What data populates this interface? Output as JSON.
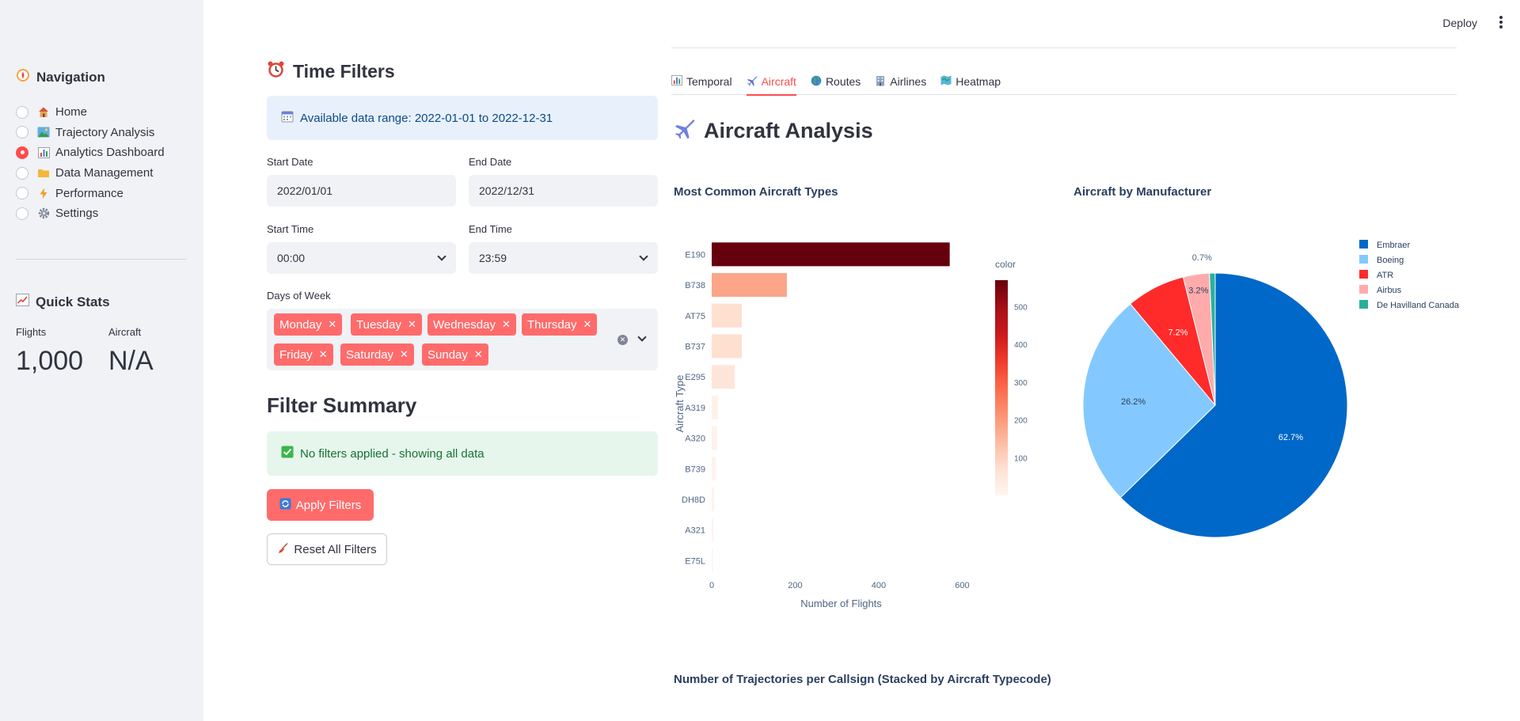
{
  "sidebar": {
    "nav_title": "Navigation",
    "nav_items": [
      {
        "label": "Home",
        "icon": "house-icon",
        "selected": false
      },
      {
        "label": "Trajectory Analysis",
        "icon": "landscape-icon",
        "selected": false
      },
      {
        "label": "Analytics Dashboard",
        "icon": "bar-chart-icon",
        "selected": true
      },
      {
        "label": "Data Management",
        "icon": "folder-icon",
        "selected": false
      },
      {
        "label": "Performance",
        "icon": "lightning-icon",
        "selected": false
      },
      {
        "label": "Settings",
        "icon": "gear-icon",
        "selected": false
      }
    ],
    "quick_stats_title": "Quick Stats",
    "metrics": [
      {
        "label": "Flights",
        "value": "1,000"
      },
      {
        "label": "Aircraft",
        "value": "N/A"
      }
    ]
  },
  "header": {
    "deploy_label": "Deploy"
  },
  "filters": {
    "title": "Time Filters",
    "info_text": "Available data range: 2022-01-01 to 2022-12-31",
    "start_date_label": "Start Date",
    "start_date_value": "2022/01/01",
    "end_date_label": "End Date",
    "end_date_value": "2022/12/31",
    "start_time_label": "Start Time",
    "start_time_value": "00:00",
    "end_time_label": "End Time",
    "end_time_value": "23:59",
    "days_label": "Days of Week",
    "days": [
      "Monday",
      "Tuesday",
      "Wednesday",
      "Thursday",
      "Friday",
      "Saturday",
      "Sunday"
    ],
    "summary_title": "Filter Summary",
    "summary_text": "No filters applied - showing all data",
    "apply_label": "Apply Filters",
    "reset_label": "Reset All Filters"
  },
  "tabs": [
    {
      "label": "Temporal",
      "icon": "bar-chart-icon",
      "active": false
    },
    {
      "label": "Aircraft",
      "icon": "airplane-icon",
      "active": true
    },
    {
      "label": "Routes",
      "icon": "globe-icon",
      "active": false
    },
    {
      "label": "Airlines",
      "icon": "office-building-icon",
      "active": false
    },
    {
      "label": "Heatmap",
      "icon": "map-icon",
      "active": false
    }
  ],
  "analysis": {
    "title": "Aircraft Analysis",
    "bar_title": "Most Common Aircraft Types",
    "pie_title": "Aircraft by Manufacturer",
    "bottom_title": "Number of Trajectories per Callsign (Stacked by Aircraft Typecode)"
  },
  "colors": {
    "accent": "#ff4b4b",
    "tag": "#ff6b6b",
    "sidebar_bg": "#f0f2f6"
  },
  "chart_data": [
    {
      "type": "bar",
      "orientation": "horizontal",
      "title": "Most Common Aircraft Types",
      "categories": [
        "E190",
        "B738",
        "AT75",
        "B737",
        "E295",
        "A319",
        "A320",
        "B739",
        "DH8D",
        "A321",
        "E75L"
      ],
      "values": [
        570,
        180,
        72,
        72,
        55,
        15,
        13,
        10,
        6,
        4,
        3
      ],
      "xlabel": "Number of Flights",
      "ylabel": "Aircraft Type",
      "xlim": [
        0,
        620
      ],
      "xticks": [
        0,
        200,
        400,
        600
      ],
      "colorbar": {
        "title": "color",
        "ticks": [
          100,
          200,
          300,
          400,
          500
        ],
        "range": [
          0,
          570
        ]
      }
    },
    {
      "type": "pie",
      "title": "Aircraft by Manufacturer",
      "labels": [
        "Embraer",
        "Boeing",
        "ATR",
        "Airbus",
        "De Havilland Canada"
      ],
      "values": [
        62.7,
        26.2,
        7.2,
        3.2,
        0.7
      ],
      "display": [
        "62.7%",
        "26.2%",
        "7.2%",
        "3.2%",
        "0.7%"
      ],
      "colors": [
        "#0068c9",
        "#83c9ff",
        "#ff2b2b",
        "#ffabab",
        "#29b09d"
      ],
      "legend": "top-right"
    }
  ]
}
